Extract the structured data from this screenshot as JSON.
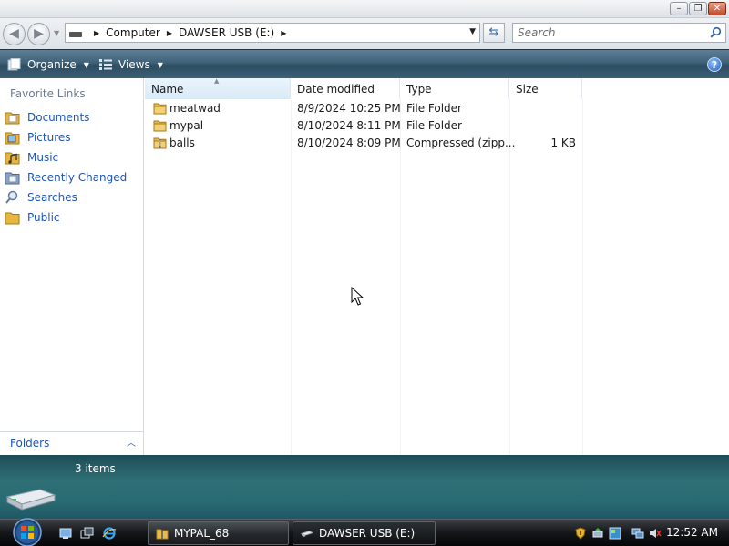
{
  "window": {
    "controls": {
      "minimize": "–",
      "maximize": "❐",
      "close": "✕"
    }
  },
  "address": {
    "breadcrumbs": [
      "Computer",
      "DAWSER USB (E:)"
    ],
    "search_placeholder": "Search"
  },
  "commandbar": {
    "organize_label": "Organize",
    "views_label": "Views",
    "help_label": "?"
  },
  "nav": {
    "favorite_links_title": "Favorite Links",
    "items": [
      {
        "label": "Documents",
        "icon": "documents-folder-icon"
      },
      {
        "label": "Pictures",
        "icon": "pictures-folder-icon"
      },
      {
        "label": "Music",
        "icon": "music-folder-icon"
      },
      {
        "label": "Recently Changed",
        "icon": "recently-changed-icon"
      },
      {
        "label": "Searches",
        "icon": "searches-icon"
      },
      {
        "label": "Public",
        "icon": "public-folder-icon"
      }
    ],
    "folders_label": "Folders"
  },
  "filelist": {
    "columns": [
      "Name",
      "Date modified",
      "Type",
      "Size"
    ],
    "sorted_column": "Name",
    "rows": [
      {
        "name": "meatwad",
        "date": "8/9/2024 10:25 PM",
        "type": "File Folder",
        "size": "",
        "icon": "folder-icon"
      },
      {
        "name": "mypal",
        "date": "8/10/2024 8:11 PM",
        "type": "File Folder",
        "size": "",
        "icon": "folder-icon"
      },
      {
        "name": "balls",
        "date": "8/10/2024 8:09 PM",
        "type": "Compressed (zipp...",
        "size": "1 KB",
        "icon": "zip-folder-icon"
      }
    ]
  },
  "details": {
    "item_count": "3 items"
  },
  "taskbar": {
    "buttons": [
      {
        "label": "MYPAL_68",
        "icon": "folder-icon"
      },
      {
        "label": "DAWSER USB (E:)",
        "icon": "usb-drive-icon"
      }
    ],
    "clock": "12:52 AM"
  },
  "colors": {
    "link_blue": "#1f55b5",
    "commandbar": "#3f6178",
    "details_pane": "#2a6c74",
    "taskbar": "#141619"
  }
}
